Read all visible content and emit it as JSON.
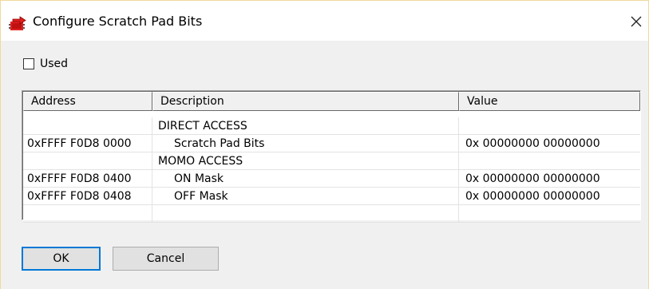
{
  "window": {
    "title": "Configure Scratch Pad Bits",
    "icon": "red-arrow-chip-icon",
    "close_label": "close"
  },
  "used_checkbox": {
    "label": "Used",
    "checked": false
  },
  "table": {
    "columns": [
      "Address",
      "Description",
      "Value"
    ],
    "rows": [
      {
        "address": "",
        "description": "DIRECT ACCESS",
        "value": "",
        "indent": false
      },
      {
        "address": "0xFFFF F0D8 0000",
        "description": "Scratch Pad Bits",
        "value": "0x 00000000  00000000",
        "indent": true
      },
      {
        "address": "",
        "description": "MOMO ACCESS",
        "value": "",
        "indent": false
      },
      {
        "address": "0xFFFF F0D8 0400",
        "description": "ON Mask",
        "value": "0x 00000000  00000000",
        "indent": true
      },
      {
        "address": "0xFFFF F0D8 0408",
        "description": "OFF Mask",
        "value": "0x 00000000  00000000",
        "indent": true
      },
      {
        "address": "",
        "description": "",
        "value": "",
        "indent": false
      }
    ]
  },
  "buttons": {
    "ok_label": "OK",
    "cancel_label": "Cancel"
  },
  "colors": {
    "accent": "#0078d7",
    "icon_red": "#e02020"
  }
}
